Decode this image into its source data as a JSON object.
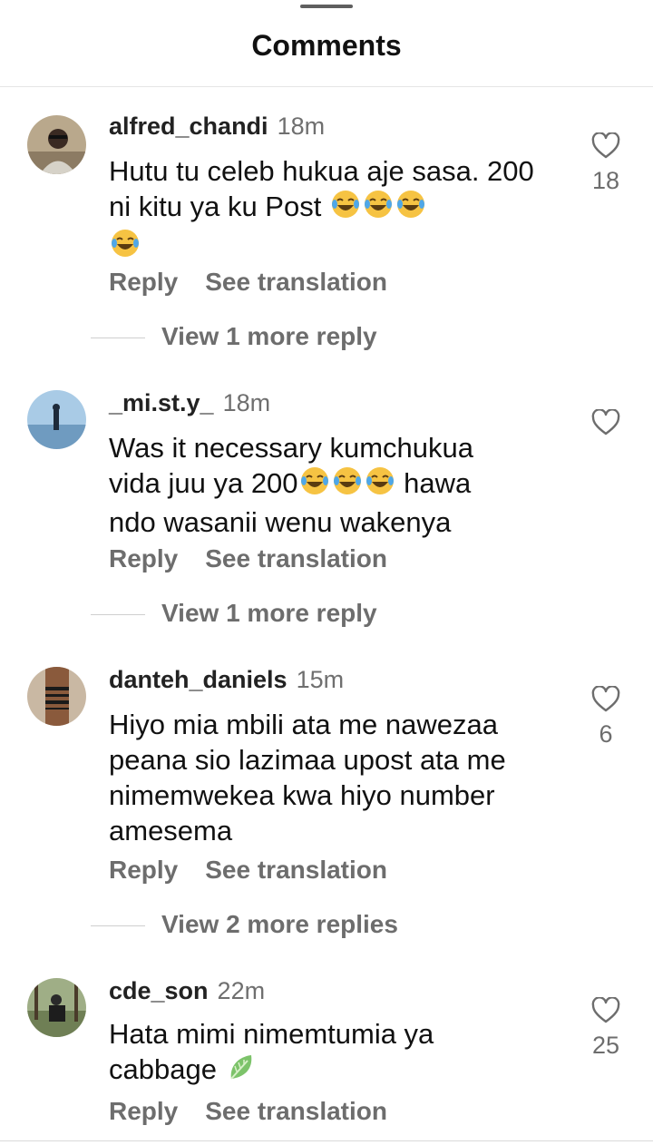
{
  "header": {
    "title": "Comments"
  },
  "comments": [
    {
      "username": "alfred_chandi",
      "time": "18m",
      "text": "Hutu tu celeb hukua aje sasa. 200 ni kitu ya ku Post",
      "emoji_after": [
        "laughing-tears",
        "laughing-tears",
        "laughing-tears",
        "laughing-tears"
      ],
      "reply_label": "Reply",
      "translate_label": "See translation",
      "likes": "18",
      "view_replies": "View 1 more reply"
    },
    {
      "username": "_mi.st.y_",
      "time": "18m",
      "text_line1": "Was it necessary kumchukua",
      "text_line2a": "vida juu ya 200",
      "text_line2b": " hawa",
      "text_line3": "ndo wasanii wenu wakenya",
      "reply_label": "Reply",
      "translate_label": "See translation",
      "likes": "",
      "view_replies": "View 1 more reply"
    },
    {
      "username": "danteh_daniels",
      "time": "15m",
      "text": "Hiyo mia mbili ata me nawezaa peana sio lazimaa upost ata me nimemwekea kwa hiyo number amesema",
      "reply_label": "Reply",
      "translate_label": "See translation",
      "likes": "6",
      "view_replies": "View 2 more replies"
    },
    {
      "username": "cde_son",
      "time": "22m",
      "text": "Hata mimi nimemtumia ya cabbage",
      "reply_label": "Reply",
      "translate_label": "See translation",
      "likes": "25"
    }
  ],
  "icons": {
    "like": "heart-outline-icon",
    "emoji": "laughing-tears-emoji",
    "cabbage": "leafy-green-emoji"
  },
  "colors": {
    "text": "#111111",
    "muted": "#6d6d6d",
    "emoji_face": "#f6c343"
  }
}
